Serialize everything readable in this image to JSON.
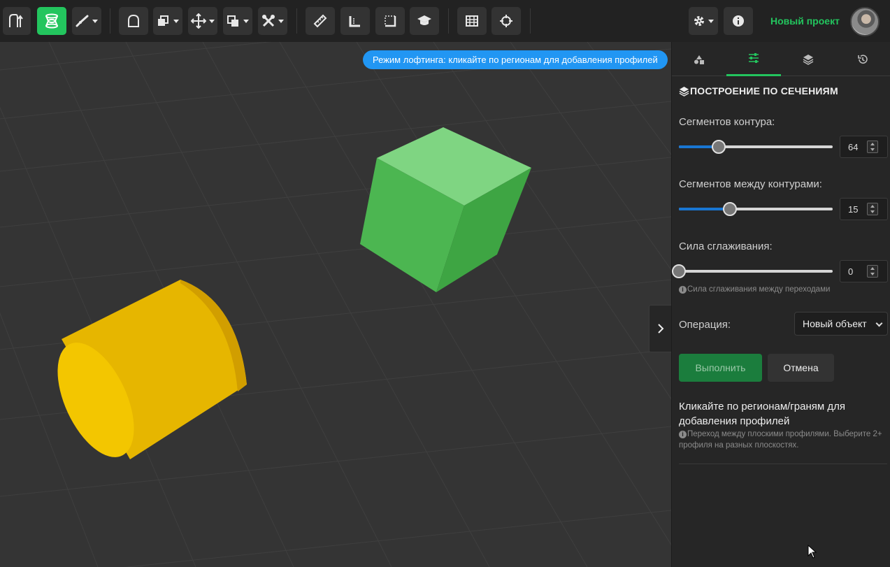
{
  "toolbar": {
    "tools": [
      {
        "name": "sketch-tool",
        "icon": "sketch-icon",
        "active": false
      },
      {
        "name": "loft-tool",
        "icon": "loft-icon",
        "active": true
      },
      {
        "name": "line-tool",
        "icon": "pen-line-icon",
        "active": false
      },
      {
        "name": "shape-tool",
        "icon": "arch-icon",
        "active": false
      },
      {
        "name": "extrude-tool",
        "icon": "extrude-icon",
        "active": false
      },
      {
        "name": "move-tool",
        "icon": "move-icon",
        "active": false
      },
      {
        "name": "boolean-tool",
        "icon": "boolean-icon",
        "active": false
      },
      {
        "name": "modify-tool",
        "icon": "tools-icon",
        "active": false
      },
      {
        "name": "measure-tool",
        "icon": "ruler-icon",
        "active": false
      },
      {
        "name": "angle-tool",
        "icon": "angle-ruler-icon",
        "active": false
      },
      {
        "name": "bounds-tool",
        "icon": "bounds-icon",
        "active": false
      },
      {
        "name": "tutorial-tool",
        "icon": "graduation-cap-icon",
        "active": false
      },
      {
        "name": "grid-tool",
        "icon": "grid-icon",
        "active": false
      },
      {
        "name": "snap-tool",
        "icon": "crosshair-icon",
        "active": false
      }
    ],
    "settings_icon": "gear-icon",
    "info_icon": "info-icon",
    "project_name": "Новый проект"
  },
  "viewport": {
    "hint": "Режим лофтинга: кликайте по регионам для добавления профилей",
    "objects": [
      {
        "name": "green-cube",
        "color": "#4cb651"
      },
      {
        "name": "yellow-cylinder",
        "color": "#e9b800"
      }
    ]
  },
  "panel": {
    "tabs": [
      {
        "name": "tab-objects",
        "icon": "shapes-icon",
        "active": false
      },
      {
        "name": "tab-parameters",
        "icon": "sliders-icon",
        "active": true
      },
      {
        "name": "tab-layers",
        "icon": "layers-icon",
        "active": false
      },
      {
        "name": "tab-history",
        "icon": "history-icon",
        "active": false
      }
    ],
    "title": "ПОСТРОЕНИЕ ПО СЕЧЕНИЯМ",
    "contour_segments": {
      "label": "Сегментов контура:",
      "value": "64",
      "fraction": 0.26
    },
    "between_segments": {
      "label": "Сегментов между контурами:",
      "value": "15",
      "fraction": 0.33
    },
    "smoothing": {
      "label": "Сила сглаживания:",
      "value": "0",
      "fraction": 0.0,
      "help": "Сила сглаживания между переходами"
    },
    "operation": {
      "label": "Операция:",
      "selected": "Новый объект"
    },
    "execute_label": "Выполнить",
    "cancel_label": "Отмена",
    "instruction": "Кликайте по регионам/граням для добавления профилей",
    "instruction_help": "Переход между плоскими профилями. Выберите 2+ профиля на разных плоскостях."
  },
  "colors": {
    "accent": "#23c55e",
    "hint_blue": "#2196f3",
    "slider_blue": "#1976d2"
  }
}
